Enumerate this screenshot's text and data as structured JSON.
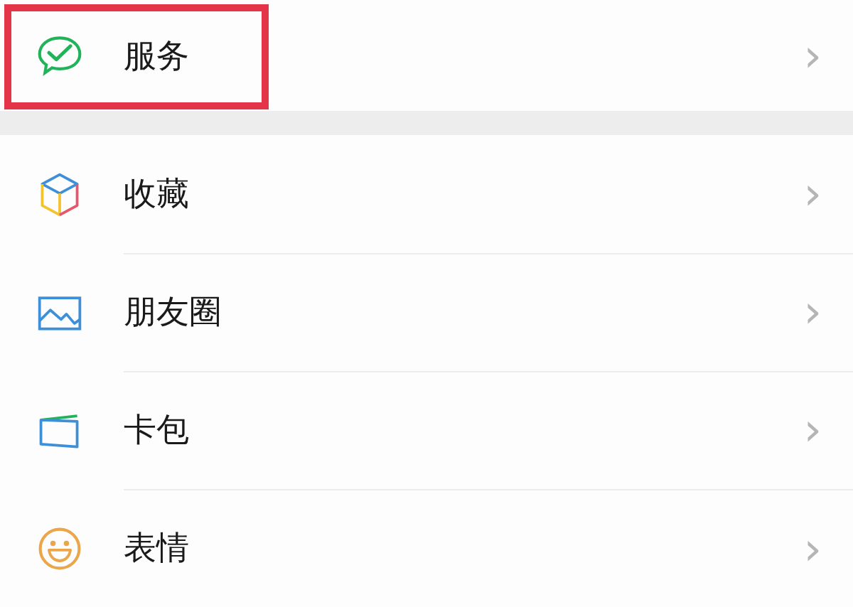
{
  "groups": [
    {
      "items": [
        {
          "label": "服务",
          "arrow": "›",
          "highlighted": true
        }
      ]
    },
    {
      "items": [
        {
          "label": "收藏",
          "arrow": "›",
          "highlighted": false
        },
        {
          "label": "朋友圈",
          "arrow": "›",
          "highlighted": false
        },
        {
          "label": "卡包",
          "arrow": "›",
          "highlighted": false
        },
        {
          "label": "表情",
          "arrow": "›",
          "highlighted": false
        }
      ]
    }
  ]
}
